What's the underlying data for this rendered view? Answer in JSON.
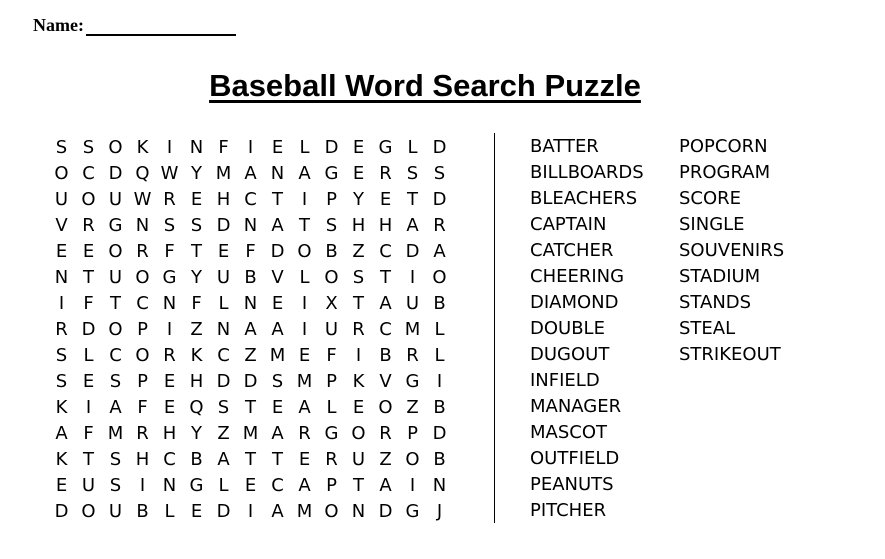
{
  "header": {
    "name_label": "Name:",
    "title": "Baseball Word Search Puzzle"
  },
  "grid": [
    [
      "S",
      "S",
      "O",
      "K",
      "I",
      "N",
      "F",
      "I",
      "E",
      "L",
      "D",
      "E",
      "G",
      "L",
      "D"
    ],
    [
      "O",
      "C",
      "D",
      "Q",
      "W",
      "Y",
      "M",
      "A",
      "N",
      "A",
      "G",
      "E",
      "R",
      "S",
      "S"
    ],
    [
      "U",
      "O",
      "U",
      "W",
      "R",
      "E",
      "H",
      "C",
      "T",
      "I",
      "P",
      "Y",
      "E",
      "T",
      "D"
    ],
    [
      "V",
      "R",
      "G",
      "N",
      "S",
      "S",
      "D",
      "N",
      "A",
      "T",
      "S",
      "H",
      "H",
      "A",
      "R"
    ],
    [
      "E",
      "E",
      "O",
      "R",
      "F",
      "T",
      "E",
      "F",
      "D",
      "O",
      "B",
      "Z",
      "C",
      "D",
      "A"
    ],
    [
      "N",
      "T",
      "U",
      "O",
      "G",
      "Y",
      "U",
      "B",
      "V",
      "L",
      "O",
      "S",
      "T",
      "I",
      "O"
    ],
    [
      "I",
      "F",
      "T",
      "C",
      "N",
      "F",
      "L",
      "N",
      "E",
      "I",
      "X",
      "T",
      "A",
      "U",
      "B"
    ],
    [
      "R",
      "D",
      "O",
      "P",
      "I",
      "Z",
      "N",
      "A",
      "A",
      "I",
      "U",
      "R",
      "C",
      "M",
      "L"
    ],
    [
      "S",
      "L",
      "C",
      "O",
      "R",
      "K",
      "C",
      "Z",
      "M",
      "E",
      "F",
      "I",
      "B",
      "R",
      "L"
    ],
    [
      "S",
      "E",
      "S",
      "P",
      "E",
      "H",
      "D",
      "D",
      "S",
      "M",
      "P",
      "K",
      "V",
      "G",
      "I"
    ],
    [
      "K",
      "I",
      "A",
      "F",
      "E",
      "Q",
      "S",
      "T",
      "E",
      "A",
      "L",
      "E",
      "O",
      "Z",
      "B"
    ],
    [
      "A",
      "F",
      "M",
      "R",
      "H",
      "Y",
      "Z",
      "M",
      "A",
      "R",
      "G",
      "O",
      "R",
      "P",
      "D"
    ],
    [
      "K",
      "T",
      "S",
      "H",
      "C",
      "B",
      "A",
      "T",
      "T",
      "E",
      "R",
      "U",
      "Z",
      "O",
      "B"
    ],
    [
      "E",
      "U",
      "S",
      "I",
      "N",
      "G",
      "L",
      "E",
      "C",
      "A",
      "P",
      "T",
      "A",
      "I",
      "N"
    ],
    [
      "D",
      "O",
      "U",
      "B",
      "L",
      "E",
      "D",
      "I",
      "A",
      "M",
      "O",
      "N",
      "D",
      "G",
      "J"
    ]
  ],
  "word_list": {
    "column1": [
      "BATTER",
      "BILLBOARDS",
      "BLEACHERS",
      "CAPTAIN",
      "CATCHER",
      "CHEERING",
      "DIAMOND",
      "DOUBLE",
      "DUGOUT",
      "INFIELD",
      "MANAGER",
      "MASCOT",
      "OUTFIELD",
      "PEANUTS",
      "PITCHER"
    ],
    "column2": [
      "POPCORN",
      "PROGRAM",
      "SCORE",
      "SINGLE",
      "SOUVENIRS",
      "STADIUM",
      "STANDS",
      "STEAL",
      "STRIKEOUT"
    ]
  }
}
